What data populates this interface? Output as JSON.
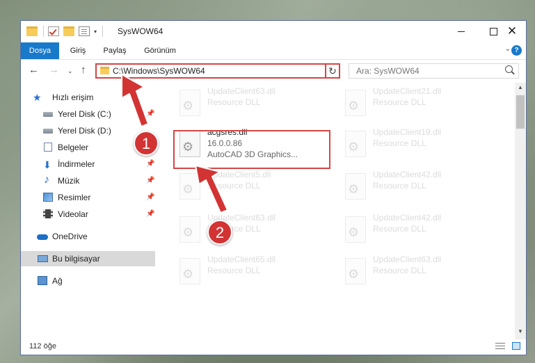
{
  "window": {
    "title": "SysWOW64"
  },
  "ribbon": {
    "tabs": [
      "Dosya",
      "Giriş",
      "Paylaş",
      "Görünüm"
    ],
    "help": "?"
  },
  "address": {
    "path": "C:\\Windows\\SysWOW64",
    "search_placeholder": "Ara: SysWOW64"
  },
  "sidebar": {
    "items": [
      {
        "label": "Hızlı erişim"
      },
      {
        "label": "Yerel Disk (C:)"
      },
      {
        "label": "Yerel Disk (D:)"
      },
      {
        "label": "Belgeler"
      },
      {
        "label": "İndirmeler"
      },
      {
        "label": "Müzik"
      },
      {
        "label": "Resimler"
      },
      {
        "label": "Videolar"
      },
      {
        "label": "OneDrive"
      },
      {
        "label": "Bu bilgisayar"
      },
      {
        "label": "Ağ"
      }
    ]
  },
  "files": {
    "focused": {
      "name": "acgsres.dll",
      "version": "16.0.0.86",
      "description": "AutoCAD 3D Graphics..."
    },
    "ghost": [
      {
        "name": "UpdateClient63.dll",
        "type": "Resource DLL"
      },
      {
        "name": "UpdateClient21.dll",
        "type": "Resource DLL"
      },
      {
        "name": "UpdateClient19.dll",
        "type": "Resource DLL"
      },
      {
        "name": "UpdateClient5.dll",
        "type": "Resource DLL"
      },
      {
        "name": "UpdateClient42.dll",
        "type": "Resource DLL"
      },
      {
        "name": "UpdateClient63.dll",
        "type": "Resource DLL"
      },
      {
        "name": "UpdateClient42.dll",
        "type": "Resource DLL"
      },
      {
        "name": "UpdateClient65.dll",
        "type": "Resource DLL"
      },
      {
        "name": "UpdateClient63.dll",
        "type": "Resource DLL"
      }
    ]
  },
  "status": {
    "count": "112 öğe"
  },
  "annotations": {
    "step1": "1",
    "step2": "2"
  },
  "colors": {
    "accent": "#1979ca",
    "highlight": "#d64545"
  }
}
